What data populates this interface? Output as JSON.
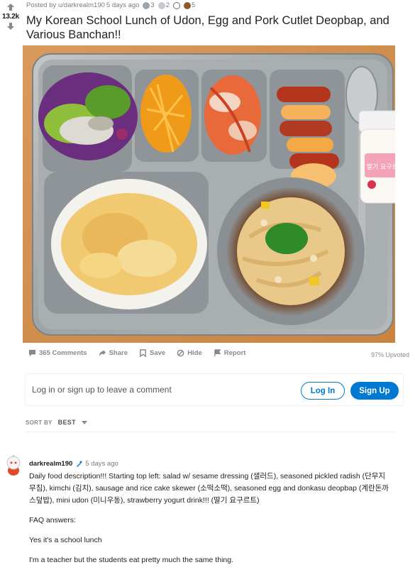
{
  "post": {
    "score": "13.2k",
    "posted_by": "Posted by u/darkrealm190",
    "age": "5 days ago",
    "awards": [
      {
        "count": "3",
        "color": "#9aa4ad",
        "icon": "silver-award-icon"
      },
      {
        "count": "2",
        "color": "#b8bec4",
        "icon": "helpful-award-icon"
      },
      {
        "count": "",
        "color": "#6b6b6b",
        "icon": "wholesome-award-icon"
      },
      {
        "count": "5",
        "color": "#8a5a2b",
        "icon": "bronze-award-icon"
      }
    ],
    "title": "My Korean School Lunch of Udon, Egg and Pork Cutlet Deopbap, and Various Banchan!!",
    "actions": {
      "comments": "365 Comments",
      "share": "Share",
      "save": "Save",
      "hide": "Hide",
      "report": "Report"
    },
    "upvoted": "97% Upvoted"
  },
  "login_prompt": {
    "text": "Log in or sign up to leave a comment",
    "login_label": "Log In",
    "signup_label": "Sign Up"
  },
  "sort": {
    "label": "SORT BY",
    "value": "BEST"
  },
  "comment": {
    "user": "darkrealm190",
    "time": "5 days ago",
    "paragraphs": [
      "Daily food description!!! Starting top left:  salad w/ sesame dressing (샐러드), seasoned pickled radish (단무지무침), kimchi (김치), sausage and rice cake skewer (소떡소떡), seasoned egg and donkasu deopbap (계란돈까스덮밥), mini udon (미니우동), strawberry yogurt drink!!! (딸기 요구르트)",
      "FAQ answers:",
      "Yes it's a school lunch",
      "I'm a teacher but the students eat pretty much the same thing."
    ]
  },
  "drink_label": "딸기 요구르트"
}
